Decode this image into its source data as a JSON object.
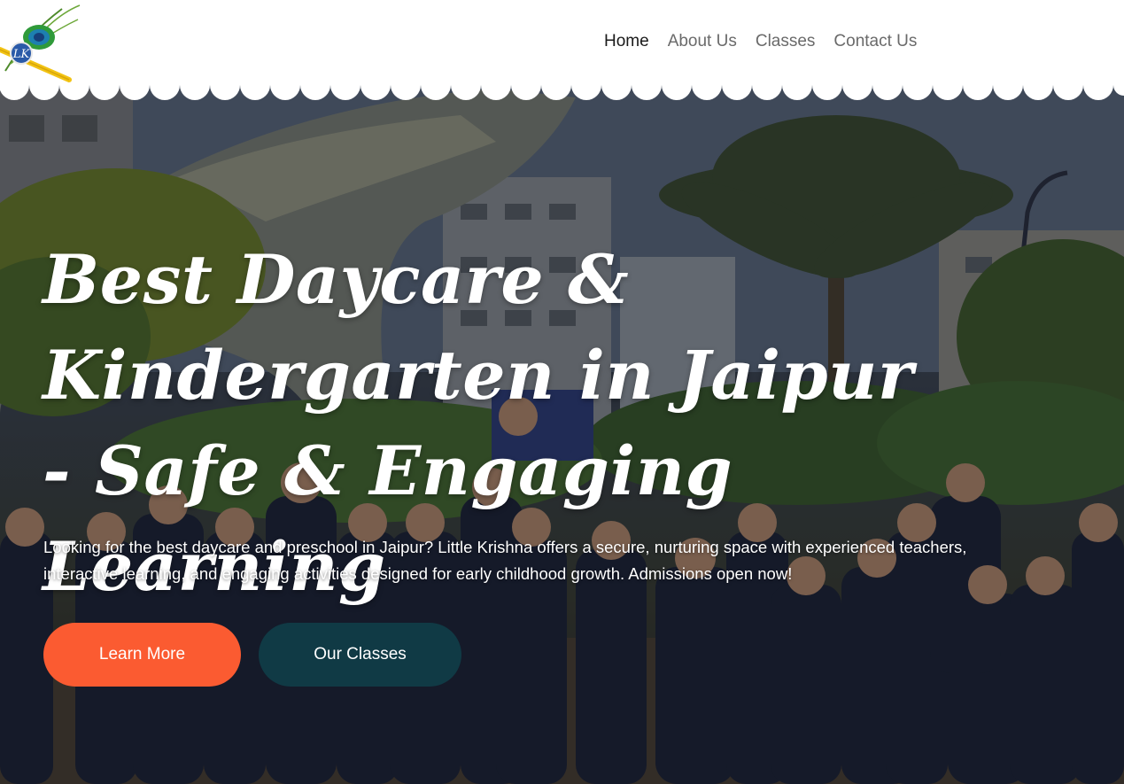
{
  "nav": {
    "items": [
      {
        "label": "Home",
        "active": true
      },
      {
        "label": "About Us",
        "active": false
      },
      {
        "label": "Classes",
        "active": false
      },
      {
        "label": "Contact Us",
        "active": false
      }
    ]
  },
  "logo": {
    "icon": "peacock-feather-flute-icon",
    "monogram": "LK"
  },
  "hero": {
    "headline": "Best Daycare & Kindergarten in Jaipur - Safe & Engaging Learning",
    "intro": "Looking for the best daycare and preschool in Jaipur? Little Krishna offers a secure, nurturing space with experienced teachers, interactive learning, and engaging activities designed for early childhood growth. Admissions open now!",
    "primary_button": "Learn More",
    "secondary_button": "Our Classes"
  },
  "colors": {
    "accent": "#fb5b31",
    "secondary": "#103a45",
    "nav_active": "#1a1a1a",
    "nav_inactive": "#6a6a6a"
  }
}
